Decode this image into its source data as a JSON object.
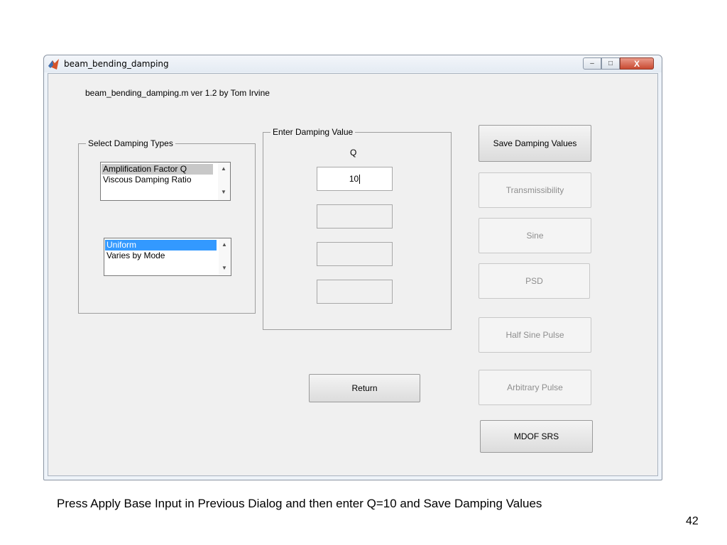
{
  "window": {
    "title": "beam_bending_damping",
    "controls": {
      "minimize": "–",
      "maximize": "□",
      "close": "X"
    }
  },
  "header_text": "beam_bending_damping.m  ver 1.2  by Tom Irvine",
  "damping_types": {
    "group_title": "Select Damping Types",
    "list1": {
      "items": [
        "Amplification Factor Q",
        "Viscous Damping Ratio"
      ],
      "selected": "Amplification Factor Q"
    },
    "list2": {
      "items": [
        "Uniform",
        "Varies by Mode"
      ],
      "selected": "Uniform"
    }
  },
  "damping_value": {
    "group_title": "Enter Damping Value",
    "label": "Q",
    "q_value": "10",
    "extra_fields": [
      "",
      "",
      ""
    ]
  },
  "buttons": {
    "save": "Save Damping Values",
    "transmissibility": "Transmissibility",
    "sine": "Sine",
    "psd": "PSD",
    "half_sine": "Half Sine Pulse",
    "arbitrary": "Arbitrary Pulse",
    "mdof": "MDOF SRS",
    "return": "Return"
  },
  "caption": "Press Apply Base Input in Previous Dialog and then enter Q=10 and Save Damping Values",
  "page_number": "42",
  "colors": {
    "selection_blue": "#3399ff",
    "selection_gray": "#c8c8c8",
    "close_red": "#c94a31"
  }
}
